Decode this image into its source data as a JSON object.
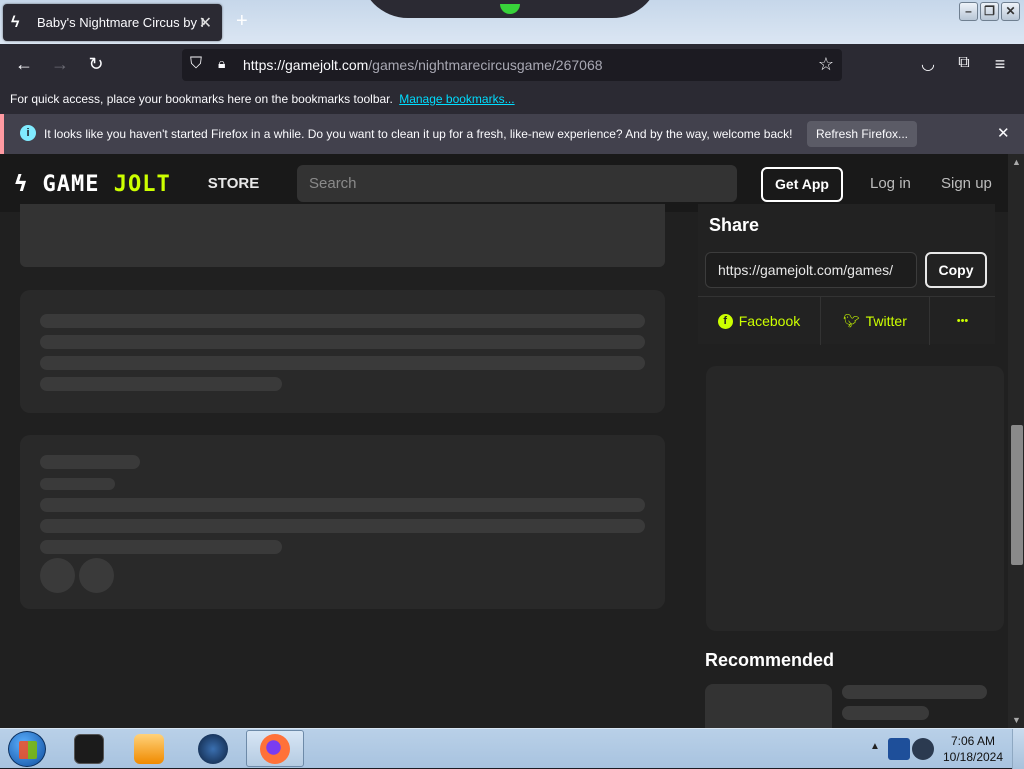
{
  "browser": {
    "tab_title": "Baby's Nightmare Circus by Mi",
    "url_host": "https://gamejolt.com",
    "url_path": "/games/nightmarecircusgame/267068",
    "bookmarks_text": "For quick access, place your bookmarks here on the bookmarks toolbar.",
    "bookmarks_link": "Manage bookmarks...",
    "notification_text": "It looks like you haven't started Firefox in a while. Do you want to clean it up for a fresh, like-new experience? And by the way, welcome back!",
    "notification_button": "Refresh Firefox...",
    "icons": [
      "back-arrow-icon",
      "forward-arrow-icon",
      "reload-icon",
      "shield-icon",
      "lock-icon",
      "bookmark-star-icon",
      "pocket-icon",
      "extensions-icon",
      "menu-icon"
    ]
  },
  "site": {
    "logo_left": "GAME",
    "logo_right": "JOLT",
    "store_tab": "STORE",
    "search_placeholder": "Search",
    "get_app": "Get App",
    "login": "Log in",
    "signup": "Sign up",
    "accent": "#ccff00"
  },
  "share": {
    "title": "Share",
    "url_value": "https://gamejolt.com/games/",
    "copy": "Copy",
    "facebook": "Facebook",
    "twitter": "Twitter",
    "more": "•••"
  },
  "recommended": {
    "title": "Recommended"
  },
  "taskbar": {
    "time": "7:06 AM",
    "date": "10/18/2024"
  }
}
